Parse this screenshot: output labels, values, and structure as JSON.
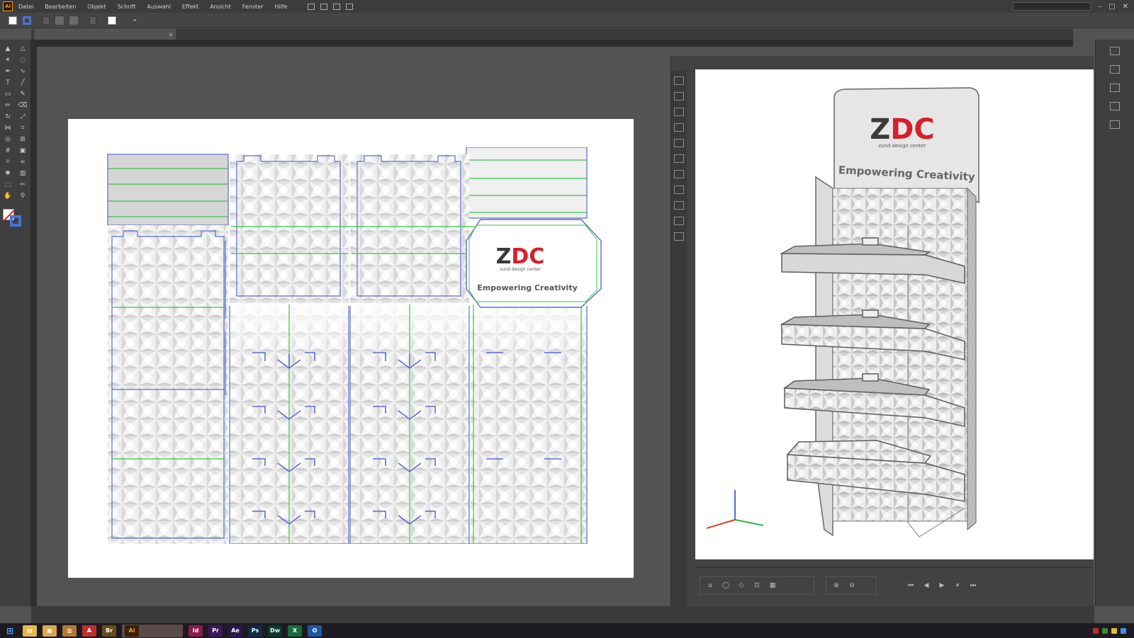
{
  "menu": {
    "items": [
      "Datei",
      "Bearbeiten",
      "Objekt",
      "Schrift",
      "Auswahl",
      "Effekt",
      "Ansicht",
      "Fenster",
      "Hilfe"
    ],
    "workspace": "",
    "search_placeholder": "",
    "window_controls": [
      "–",
      "□",
      "✕"
    ]
  },
  "controlbar": {
    "object_label": "",
    "stroke_label": "",
    "stroke_weight": "",
    "profile_field": "",
    "brush_field": "",
    "opacity_label": "",
    "opacity_value": "",
    "style_label": "",
    "recolor_button": "",
    "align_button": ""
  },
  "document": {
    "tab_title": "",
    "close_symbol": "×"
  },
  "tools": {
    "icons": [
      "selection-icon",
      "direct-selection-icon",
      "magic-wand-icon",
      "lasso-icon",
      "pen-icon",
      "curvature-icon",
      "type-icon",
      "line-icon",
      "rectangle-icon",
      "paintbrush-icon",
      "pencil-icon",
      "eraser-icon",
      "rotate-icon",
      "scale-icon",
      "width-icon",
      "free-transform-icon",
      "shape-builder-icon",
      "perspective-icon",
      "mesh-icon",
      "gradient-icon",
      "eyedropper-icon",
      "blend-icon",
      "symbol-sprayer-icon",
      "graph-icon",
      "artboard-icon",
      "slice-icon",
      "hand-icon",
      "zoom-icon"
    ],
    "glyphs": [
      "▲",
      "△",
      "✶",
      "◌",
      "✒",
      "∿",
      "T",
      "╱",
      "▭",
      "✎",
      "✏",
      "⌫",
      "↻",
      "⤢",
      "⋈",
      "⌗",
      "◎",
      "⊞",
      "#",
      "▣",
      "⌾",
      "∞",
      "✺",
      "▥",
      "⬚",
      "✂",
      "✋",
      "⚲"
    ]
  },
  "artwork": {
    "brand": "ZDC",
    "brand_z": "Z",
    "brand_dc": "DC",
    "subline": "zund design center",
    "tagline": "Empowering Creativity",
    "colors": {
      "cut_line": "#5a6ccf",
      "crease_line": "#3cc04a",
      "brand_dark": "#3a3a3a",
      "brand_red": "#d4202a"
    }
  },
  "panel3d": {
    "title": "",
    "side_icons": [
      "cube-icon",
      "sphere-icon",
      "camera-icon",
      "light-icon",
      "material-icon",
      "layers-icon",
      "box-icon",
      "folder-icon",
      "image-icon",
      "export-icon",
      "settings-icon"
    ],
    "transport": {
      "view_label": "",
      "zoom_label": "",
      "anim_label": "",
      "view_buttons": [
        "⌂",
        "◯",
        "◇",
        "⊡",
        "▦"
      ],
      "zoom_buttons": [
        "⊕",
        "⊖"
      ],
      "anim_buttons": [
        "⏮",
        "◀",
        "▶",
        "⏸",
        "⏭"
      ]
    }
  },
  "dock": {
    "icons": [
      "color-icon",
      "swatches-icon",
      "brushes-icon",
      "symbols-icon",
      "graphic-styles-icon"
    ]
  },
  "taskbar": {
    "start": "⊞",
    "apps": [
      {
        "name": "file-explorer-icon",
        "color": "#e8b84a",
        "glyph": "▤"
      },
      {
        "name": "folder-icon",
        "color": "#d8a84a",
        "glyph": "▦"
      },
      {
        "name": "archive-icon",
        "color": "#b07a30",
        "glyph": "▥"
      },
      {
        "name": "acrobat-icon",
        "color": "#c0302a",
        "glyph": "A"
      },
      {
        "name": "bridge-icon",
        "color": "#6a4a18",
        "glyph": "Br"
      },
      {
        "name": "indesign-icon",
        "color": "#8a1a4a",
        "glyph": "Id"
      },
      {
        "name": "premiere-icon",
        "color": "#3a1a5a",
        "glyph": "Pr"
      },
      {
        "name": "after-effects-icon",
        "color": "#2a1a4a",
        "glyph": "Ae"
      },
      {
        "name": "photoshop-icon",
        "color": "#102a4a",
        "glyph": "Ps"
      },
      {
        "name": "dreamweaver-icon",
        "color": "#0a3a2a",
        "glyph": "Dw"
      },
      {
        "name": "excel-icon",
        "color": "#1a6a3a",
        "glyph": "X"
      },
      {
        "name": "outlook-icon",
        "color": "#1a5aa0",
        "glyph": "O"
      }
    ],
    "active_app": {
      "name": "illustrator-icon",
      "glyph": "Ai",
      "label": ""
    },
    "clock": ""
  }
}
